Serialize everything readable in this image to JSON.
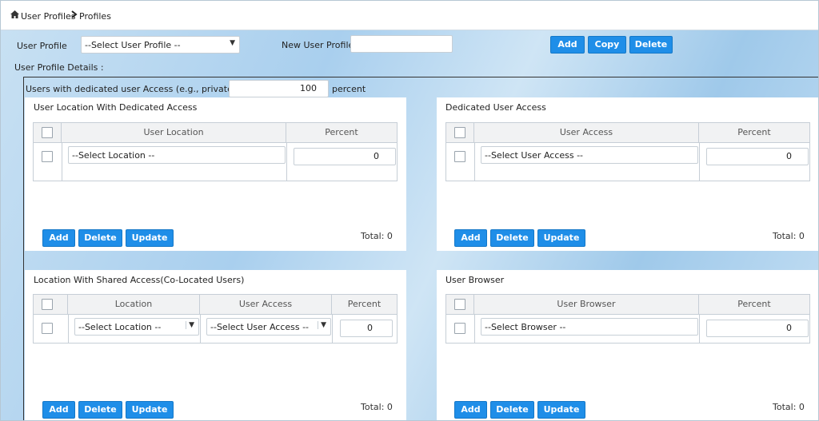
{
  "breadcrumb": {
    "home_icon": "home-icon",
    "item1": "User Profiles",
    "item2": "Profiles"
  },
  "profile_bar": {
    "user_profile_label": "User Profile",
    "user_profile_select": "--Select User Profile --",
    "new_user_profile_label": "New User Profile",
    "new_user_profile_value": "",
    "add": "Add",
    "copy": "Copy",
    "delete": "Delete"
  },
  "details_label": "User Profile Details :",
  "dedicated": {
    "label": "Users with dedicated user Access (e.g., private DSL)",
    "value": "100",
    "unit": "percent"
  },
  "panels": {
    "loc_dedicated": {
      "title": "User Location With Dedicated Access",
      "col1": "User Location",
      "col2": "Percent",
      "select": "--Select Location --",
      "percent": "0",
      "total": "Total: 0"
    },
    "ded_access": {
      "title": "Dedicated User Access",
      "col1": "User Access",
      "col2": "Percent",
      "select": "--Select User Access --",
      "percent": "0",
      "total": "Total: 0"
    },
    "loc_shared": {
      "title": "Location With Shared Access(Co-Located Users)",
      "col1": "Location",
      "col2": "User Access",
      "col3": "Percent",
      "select1": "--Select Location --",
      "select2": "--Select User Access --",
      "percent": "0",
      "total": "Total: 0"
    },
    "browser": {
      "title": "User Browser",
      "col1": "User Browser",
      "col2": "Percent",
      "select": "--Select Browser --",
      "percent": "0",
      "total": "Total: 0"
    }
  },
  "buttons": {
    "add": "Add",
    "delete": "Delete",
    "update": "Update"
  },
  "colors": {
    "accent": "#1f8ee8"
  }
}
